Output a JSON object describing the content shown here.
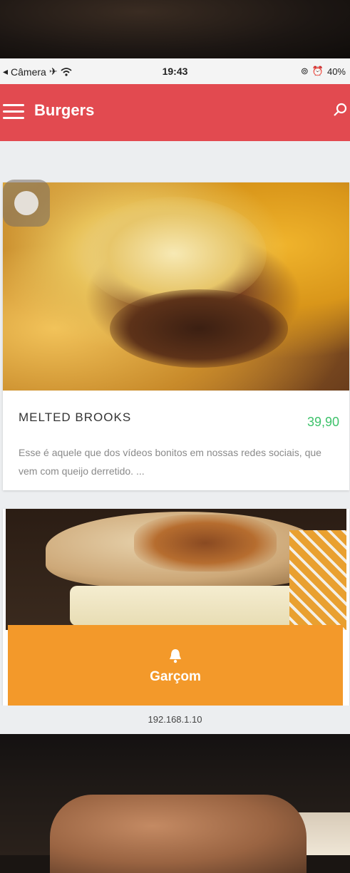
{
  "status_bar": {
    "back_label": "Câmera",
    "time": "19:43",
    "battery": "40%"
  },
  "app_bar": {
    "title": "Burgers"
  },
  "menu_items": [
    {
      "name": "MELTED BROOKS",
      "price": "39,90",
      "description": "Esse é aquele que dos vídeos bonitos em nossas redes sociais, que vem com queijo derretido. ..."
    }
  ],
  "waiter_button": {
    "label": "Garçom"
  },
  "footer": {
    "url": "192.168.1.10"
  },
  "colors": {
    "app_bar": "#e24a50",
    "price": "#3ec26b",
    "waiter_button": "#f3992a"
  },
  "icons": [
    "menu-icon",
    "search-icon",
    "bell-icon",
    "wifi-icon",
    "airplane-icon",
    "lock-rotation-icon",
    "alarm-icon"
  ]
}
